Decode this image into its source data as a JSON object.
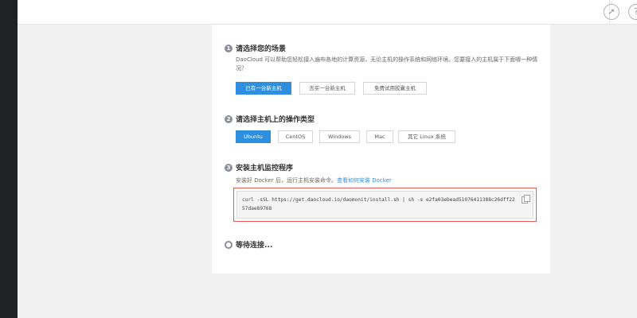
{
  "steps": [
    {
      "number": "1",
      "title": "请选择您的场景",
      "description": "DaoCloud 可以帮助您轻松接入遍布各地的计算资源，无论主机的操作系统和网络环境。您要接入的主机属于下面哪一种情况？",
      "options": [
        "已有一台新主机",
        "去买一台新主机",
        "免费试用胶囊主机"
      ],
      "selected": "已有一台新主机"
    },
    {
      "number": "2",
      "title": "请选择主机上的操作类型",
      "options": [
        "Ubuntu",
        "CentOS",
        "Windows",
        "Mac",
        "其它 Linux 系统"
      ],
      "selected": "Ubuntu"
    },
    {
      "number": "3",
      "title": "安装主机监控程序",
      "description_prefix": "安装好 Docker 后，运行主机安装命令。",
      "description_link": "查看如何安装 Docker",
      "command": "curl -sSL https://get.daocloud.io/daomonit/install.sh | sh -s e2fa03ebead51076411388c26dff2257dae89768"
    },
    {
      "title": "等待连接..."
    }
  ],
  "icons": {
    "topbar": [
      "rocket-icon",
      "help-icon"
    ],
    "copy": "copy-icon"
  },
  "colors": {
    "accent": "#2d8fdd",
    "highlight_border": "#e35b55",
    "sidebar": "#1f2225"
  }
}
